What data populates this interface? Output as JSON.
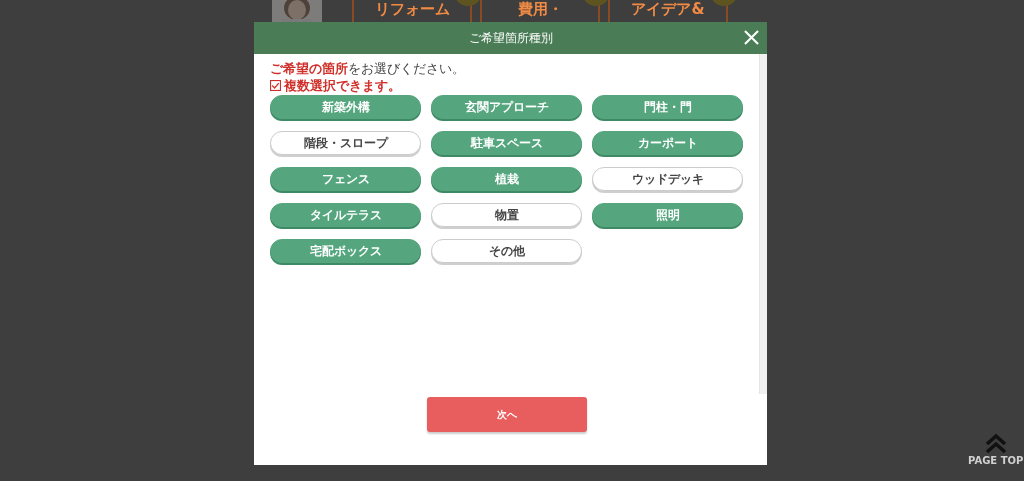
{
  "background": {
    "steps": [
      {
        "label": "リフォーム"
      },
      {
        "label": "費用・"
      },
      {
        "label": "アイデア&"
      }
    ],
    "page_top": "PAGE TOP"
  },
  "dialog": {
    "title": "ご希望箇所種別",
    "intro": "**ご希望の箇所**をお選びください。",
    "note": "複数選択できます。",
    "options": [
      {
        "label": "新築外構",
        "selected": true
      },
      {
        "label": "玄関アプローチ",
        "selected": true
      },
      {
        "label": "門柱・門",
        "selected": true
      },
      {
        "label": "階段・スロープ",
        "selected": false
      },
      {
        "label": "駐車スペース",
        "selected": true
      },
      {
        "label": "カーポート",
        "selected": true
      },
      {
        "label": "フェンス",
        "selected": true
      },
      {
        "label": "植栽",
        "selected": true
      },
      {
        "label": "ウッドデッキ",
        "selected": false
      },
      {
        "label": "タイルテラス",
        "selected": true
      },
      {
        "label": "物置",
        "selected": false
      },
      {
        "label": "照明",
        "selected": true
      },
      {
        "label": "宅配ボックス",
        "selected": true
      },
      {
        "label": "その他",
        "selected": false
      }
    ],
    "next_button": "次へ"
  }
}
